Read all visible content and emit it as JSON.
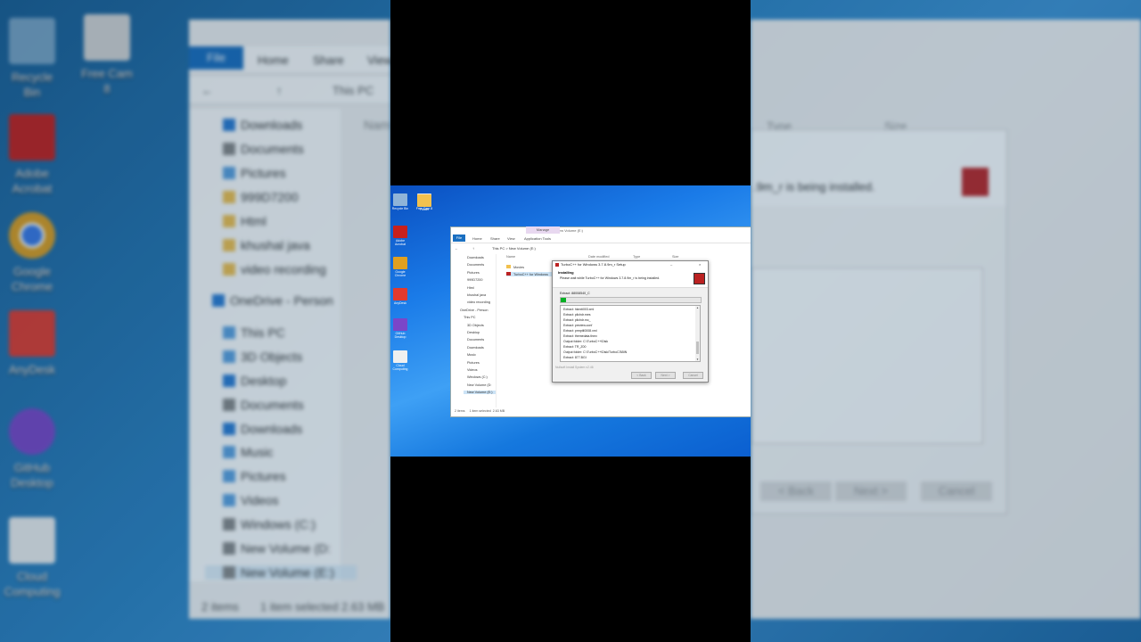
{
  "background": {
    "desktop_icons": [
      {
        "label": "Recycle Bin",
        "color": "#7aa6c8"
      },
      {
        "label": "Free Cam 8",
        "color": "#d8d8d8"
      },
      {
        "label": "Adobe Acrobat",
        "color": "#c8201c"
      },
      {
        "label": "Google Chrome",
        "color": "#e0a020"
      },
      {
        "label": "AnyDesk",
        "color": "#e23a2e"
      },
      {
        "label": "GitHub Desktop",
        "color": "#7a46c8"
      },
      {
        "label": "Cloud Computing",
        "color": "#efefef"
      }
    ],
    "explorer": {
      "file_tab": "File",
      "tabs": [
        "Home",
        "Share",
        "View"
      ],
      "address": "This PC",
      "header_name": "Nam",
      "nav": [
        "Downloads",
        "Documents",
        "Pictures",
        "999D7200",
        "Html",
        "khushal java",
        "video recording",
        "OneDrive - Person",
        "This PC",
        "3D Objects",
        "Desktop",
        "Documents",
        "Downloads",
        "Music",
        "Pictures",
        "Videos",
        "Windows (C:)",
        "New Volume (D:",
        "New Volume (E:)"
      ],
      "status_items": "2 items",
      "status_selected": "1 item selected  2.63 MB"
    },
    "right": {
      "col_type": "Type",
      "col_size": "Size",
      "install_text": ".9m_r is being installed.",
      "back": "< Back",
      "next": "Next >",
      "cancel": "Cancel"
    }
  },
  "screenshot": {
    "desktop_icons": [
      {
        "label": "Recycle Bin",
        "color": "#8fb4d8"
      },
      {
        "label": "Free Cam 8",
        "color": "#e6e6e6"
      },
      {
        "label": "Adobe Acrobat",
        "color": "#c8201c"
      },
      {
        "label": "Google Chrome",
        "color": "#e0a020"
      },
      {
        "label": "AnyDesk",
        "color": "#e23a2e"
      },
      {
        "label": "GitHub Desktop",
        "color": "#7a46c8"
      },
      {
        "label": "Cloud Computing",
        "color": "#f0f0f0"
      },
      {
        "label": "Folder",
        "color": "#f2c14e"
      }
    ],
    "explorer": {
      "title": "New Volume (E:)",
      "manage": "Manage",
      "file_tab": "File",
      "tabs": [
        "Home",
        "Share",
        "View",
        "Application Tools"
      ],
      "address": "This PC  >  New Volume (E:)",
      "columns": [
        "Name",
        "Date modified",
        "Type",
        "Size"
      ],
      "nav": [
        "Downloads",
        "Documents",
        "Pictures",
        "999D7200",
        "Html",
        "khushal java",
        "video recording",
        "OneDrive - Person",
        "This PC",
        "3D Objects",
        "Desktop",
        "Documents",
        "Downloads",
        "Music",
        "Pictures",
        "Videos",
        "Windows (C:)",
        "New Volume (D:",
        "New Volume (E:)"
      ],
      "files": [
        "Movies",
        "TurboC++ for Windows"
      ],
      "status": "2 items     1 item selected  2.63 MB"
    },
    "dialog": {
      "title": "TurboC++ for Windows 3.7.8.9m_r Setup",
      "heading": "Installing",
      "subheading": "Please wait while TurboC++ for Windows 3.7.8.9m_r is being installed.",
      "extract_status": "Extract: 88008540_C",
      "progress": 0.04,
      "log": [
        "Extract: hkexti003.xml",
        "Extract: pilchdr.mes",
        "Extract: pilchdr.mc_",
        "Extract: preview.conf",
        "Extract: prmptli0008.xml",
        "Extract: themedata.thmx",
        "Output folder: C:\\TurboC++\\Disk",
        "Extract: TR_Z00",
        "Output folder: C:\\TurboC++\\Disk\\TurboC3\\BIN",
        "Extract: 877.BGI"
      ],
      "footer": "Nullsoft Install System v2.46",
      "back": "< Back",
      "next": "Next >",
      "cancel": "Cancel",
      "min": "–",
      "close": "×"
    }
  }
}
